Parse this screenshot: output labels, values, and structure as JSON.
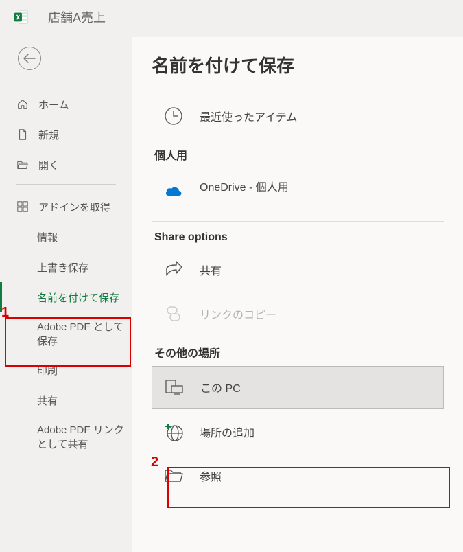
{
  "header": {
    "doc_title": "店舗A売上"
  },
  "sidebar": {
    "home": "ホーム",
    "new": "新規",
    "open": "開く",
    "addins": "アドインを取得",
    "info": "情報",
    "save": "上書き保存",
    "save_as": "名前を付けて保存",
    "adobe_save": "Adobe PDF として保存",
    "print": "印刷",
    "share": "共有",
    "adobe_link": "Adobe PDF リンクとして共有"
  },
  "main": {
    "title": "名前を付けて保存",
    "recent": "最近使ったアイテム",
    "section_personal": "個人用",
    "onedrive_title": "OneDrive - 個人用",
    "section_share": "Share options",
    "share_item": "共有",
    "copy_link": "リンクのコピー",
    "section_other": "その他の場所",
    "this_pc": "この PC",
    "add_place": "場所の追加",
    "browse": "参照"
  },
  "annotations": {
    "one": "1",
    "two": "2"
  }
}
